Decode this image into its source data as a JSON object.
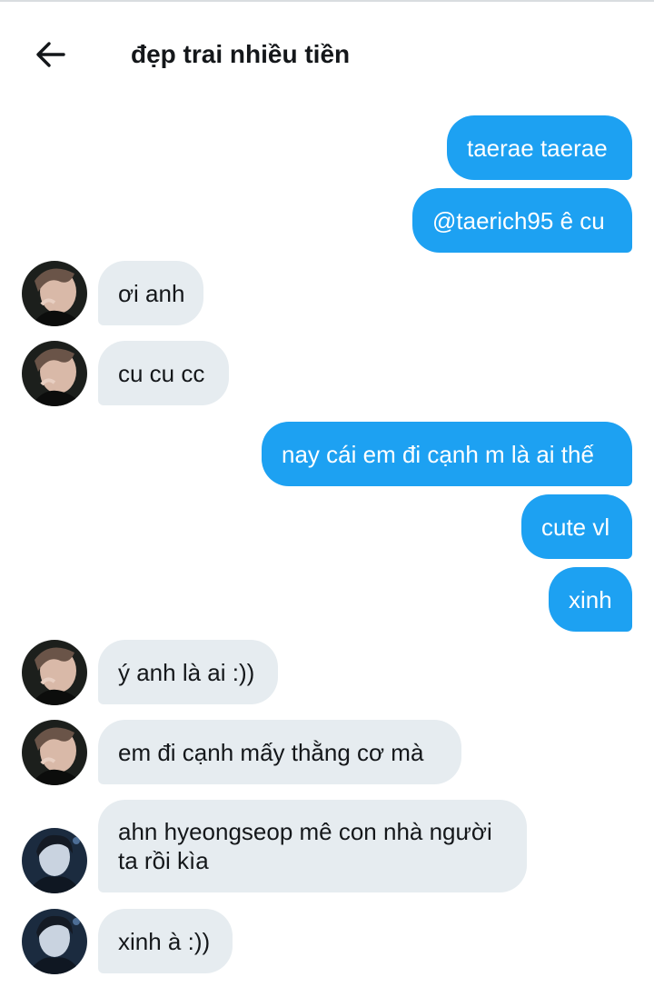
{
  "header": {
    "title": "đẹp trai nhiều tiền",
    "back_icon": "arrow-left-icon"
  },
  "messages": [
    {
      "side": "sent",
      "text": "taerae taerae"
    },
    {
      "side": "sent",
      "text": "@taerich95 ê cu"
    },
    {
      "side": "recv",
      "text": "ơi anh",
      "avatar": "avatar-a"
    },
    {
      "side": "recv",
      "text": "cu cu cc",
      "avatar": "avatar-a"
    },
    {
      "side": "sent",
      "text": "nay cái em đi cạnh m là ai thế"
    },
    {
      "side": "sent",
      "text": "cute vl"
    },
    {
      "side": "sent",
      "text": "xinh"
    },
    {
      "side": "recv",
      "text": "ý anh là ai :))",
      "avatar": "avatar-a"
    },
    {
      "side": "recv",
      "text": "em đi cạnh mấy thằng cơ mà",
      "avatar": "avatar-a"
    },
    {
      "side": "recv",
      "text": "ahn hyeongseop mê con nhà người ta rồi kìa",
      "avatar": "avatar-b"
    },
    {
      "side": "recv",
      "text": "xinh à :))",
      "avatar": "avatar-b"
    }
  ],
  "colors": {
    "sent_bubble": "#1da1f2",
    "received_bubble": "#e6ecf0",
    "text": "#14171a"
  }
}
